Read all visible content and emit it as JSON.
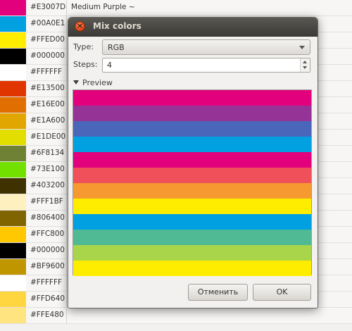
{
  "palette": [
    {
      "hex": "#E3007D",
      "color": "#E3007D",
      "name": "Medium Purple ~"
    },
    {
      "hex": "#00A0E1",
      "color": "#00A0E1",
      "name": ""
    },
    {
      "hex": "#FFED00",
      "color": "#FFED00",
      "name": ""
    },
    {
      "hex": "#000000",
      "color": "#000000",
      "name": ""
    },
    {
      "hex": "#FFFFFF",
      "color": "#FFFFFF",
      "name": ""
    },
    {
      "hex": "#E13500",
      "color": "#E13500",
      "name": ""
    },
    {
      "hex": "#E16E00",
      "color": "#E16E00",
      "name": ""
    },
    {
      "hex": "#E1A600",
      "color": "#E1A600",
      "name": ""
    },
    {
      "hex": "#E1DE00",
      "color": "#E1DE00",
      "name": ""
    },
    {
      "hex": "#6F8134",
      "color": "#6F8134",
      "name": ""
    },
    {
      "hex": "#73E100",
      "color": "#73E100",
      "name": ""
    },
    {
      "hex": "#403200",
      "color": "#403200",
      "name": ""
    },
    {
      "hex": "#FFF1BF",
      "color": "#FFF1BF",
      "name": ""
    },
    {
      "hex": "#806400",
      "color": "#806400",
      "name": ""
    },
    {
      "hex": "#FFC800",
      "color": "#FFC800",
      "name": ""
    },
    {
      "hex": "#000000",
      "color": "#000000",
      "name": ""
    },
    {
      "hex": "#BF9600",
      "color": "#BF9600",
      "name": ""
    },
    {
      "hex": "#FFFFFF",
      "color": "#FFFFFF",
      "name": ""
    },
    {
      "hex": "#FFD640",
      "color": "#FFD640",
      "name": ""
    },
    {
      "hex": "#FFE480",
      "color": "#FFE480",
      "name": ""
    }
  ],
  "dialog": {
    "title": "Mix colors",
    "close_icon": "×",
    "type_label": "Type:",
    "type_value": "RGB",
    "steps_label": "Steps:",
    "steps_value": "4",
    "preview_label": "Preview",
    "preview_colors": [
      "#E3007D",
      "#963397",
      "#4A66BB",
      "#00A0E1",
      "#E3007D",
      "#F0505A",
      "#F69930",
      "#FFED00",
      "#00A0E1",
      "#50BA94",
      "#A8D549",
      "#FFED00"
    ],
    "cancel_label": "Отменить",
    "ok_label": "OK"
  }
}
